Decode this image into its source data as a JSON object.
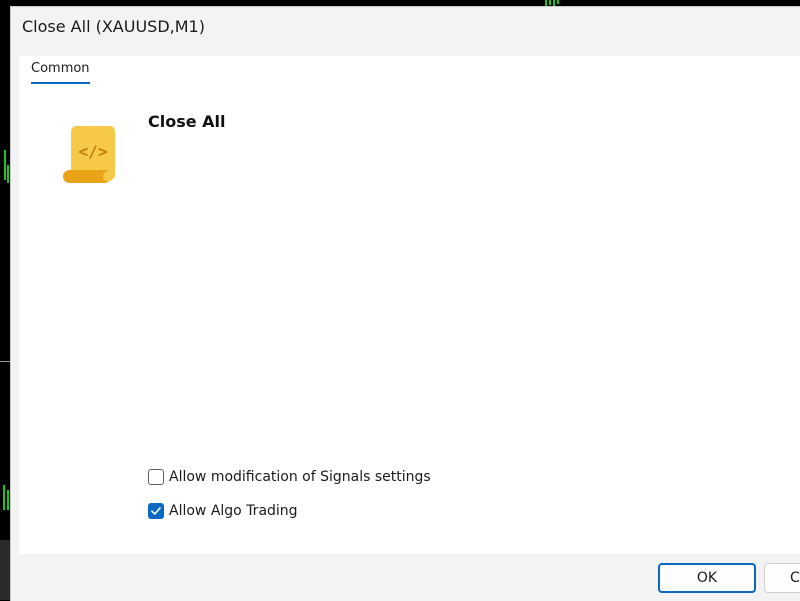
{
  "window": {
    "title": "Close All (XAUUSD,M1)"
  },
  "tabs": [
    {
      "label": "Common",
      "active": true
    }
  ],
  "program": {
    "name": "Close All",
    "icon": "script-scroll-icon"
  },
  "options": [
    {
      "label": "Allow modification of Signals settings",
      "checked": false
    },
    {
      "label": "Allow Algo Trading",
      "checked": true
    }
  ],
  "buttons": {
    "ok_label": "OK",
    "cancel_label": "C"
  },
  "colors": {
    "accent": "#0a67c2",
    "icon_yellow": "#f7c948",
    "chart_green": "#19c819"
  }
}
